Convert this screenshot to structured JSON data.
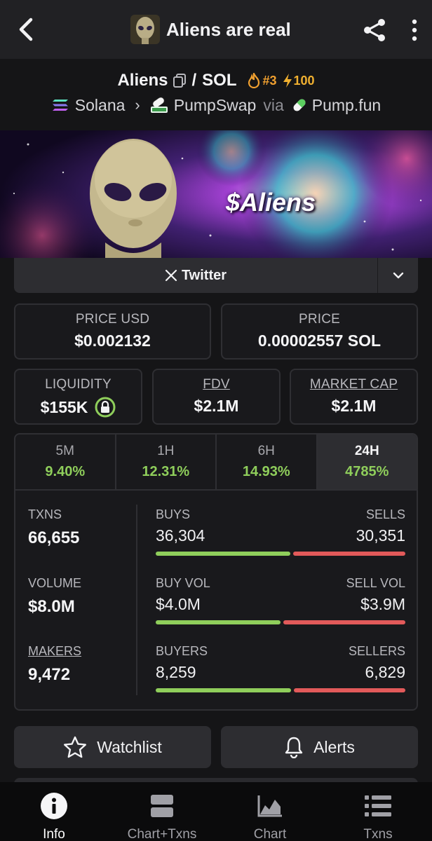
{
  "header": {
    "title": "Aliens are real"
  },
  "pair": {
    "token": "Aliens",
    "separator": "/",
    "quote": "SOL",
    "rank": "#3",
    "boost": "100"
  },
  "chain": {
    "network": "Solana",
    "dex": "PumpSwap",
    "via_label": "via",
    "launchpad": "Pump.fun"
  },
  "banner": {
    "text": "$Aliens"
  },
  "social": {
    "twitter_label": "Twitter"
  },
  "price": {
    "usd_label": "PRICE USD",
    "usd_value": "$0.002132",
    "native_label": "PRICE",
    "native_value": "0.00002557 SOL"
  },
  "stats": {
    "liquidity_label": "LIQUIDITY",
    "liquidity_value": "$155K",
    "fdv_label": "FDV",
    "fdv_value": "$2.1M",
    "mcap_label": "MARKET CAP",
    "mcap_value": "$2.1M"
  },
  "timeframes": [
    {
      "label": "5M",
      "value": "9.40%"
    },
    {
      "label": "1H",
      "value": "12.31%"
    },
    {
      "label": "6H",
      "value": "14.93%"
    },
    {
      "label": "24H",
      "value": "4785%"
    }
  ],
  "activity": {
    "txns_label": "TXNS",
    "txns_value": "66,655",
    "buys_label": "BUYS",
    "buys_value": "36,304",
    "sells_label": "SELLS",
    "sells_value": "30,351",
    "volume_label": "VOLUME",
    "volume_value": "$8.0M",
    "buy_vol_label": "BUY VOL",
    "buy_vol_value": "$4.0M",
    "sell_vol_label": "SELL VOL",
    "sell_vol_value": "$3.9M",
    "makers_label": "MAKERS",
    "makers_value": "9,472",
    "buyers_label": "BUYERS",
    "buyers_value": "8,259",
    "sellers_label": "SELLERS",
    "sellers_value": "6,829",
    "buy_share_txns": 0.545,
    "buy_share_vol": 0.506,
    "buy_share_makers": 0.547
  },
  "actions": {
    "watchlist_label": "Watchlist",
    "alerts_label": "Alerts"
  },
  "nav": [
    {
      "label": "Info",
      "icon": "info-icon"
    },
    {
      "label": "Chart+Txns",
      "icon": "chart-txns-icon"
    },
    {
      "label": "Chart",
      "icon": "chart-icon"
    },
    {
      "label": "Txns",
      "icon": "list-icon"
    }
  ],
  "colors": {
    "positive": "#8fce5b",
    "negative": "#e25a5a",
    "rank": "#f0a030",
    "background": "#151517"
  }
}
